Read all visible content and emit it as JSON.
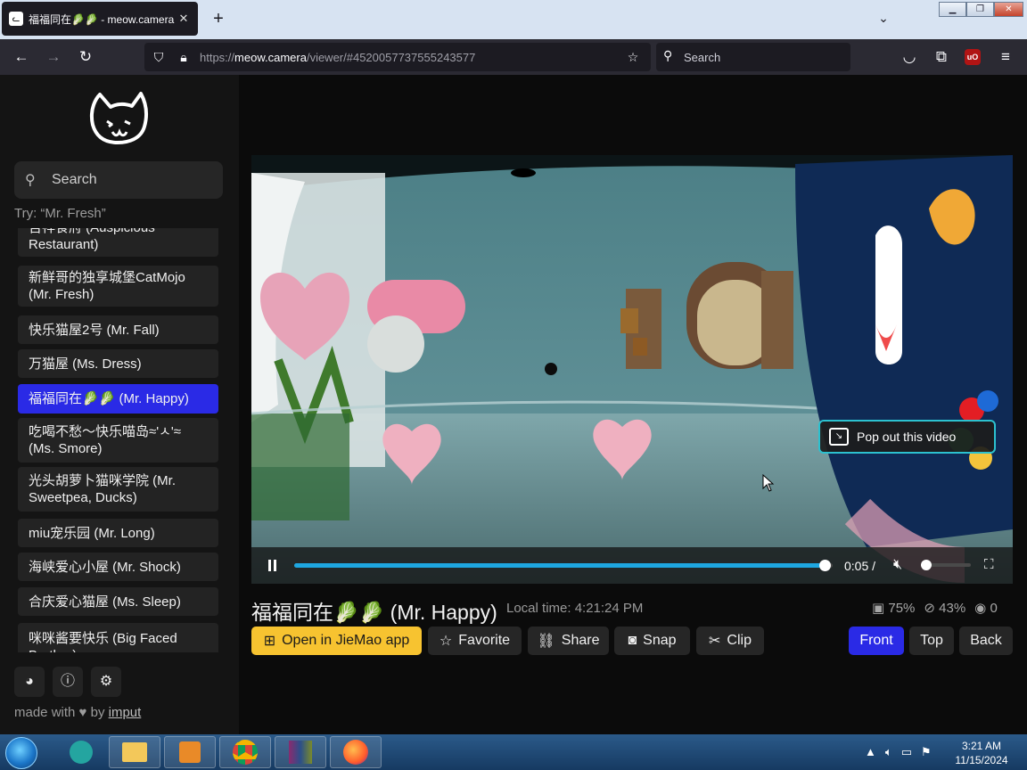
{
  "browser": {
    "tab_title": "福福同在🥬🥬 - meow.camera",
    "url_prefix": "https://",
    "url_host": "meow.camera",
    "url_path": "/viewer/#4520057737555243577",
    "search_placeholder": "Search"
  },
  "sidebar": {
    "search_placeholder": "Search",
    "hint": "Try: “Mr. Fresh”",
    "items": [
      {
        "label": "吉祥食府 (Auspicious Restaurant)"
      },
      {
        "label": "新鲜哥的独享城堡CatMojo (Mr. Fresh)"
      },
      {
        "label": "快乐猫屋2号 (Mr. Fall)"
      },
      {
        "label": "万猫屋 (Ms. Dress)"
      },
      {
        "label": "福福同在🥬🥬 (Mr. Happy)"
      },
      {
        "label": "吃喝不愁～快乐喵岛≈'ㅅ'≈ (Ms. Smore)"
      },
      {
        "label": "光头胡萝卜猫咪学院 (Mr. Sweetpea, Ducks)"
      },
      {
        "label": "miu宠乐园 (Mr. Long)"
      },
      {
        "label": "海峡爱心小屋 (Mr. Shock)"
      },
      {
        "label": "合庆爱心猫屋 (Ms. Sleep)"
      },
      {
        "label": "咪咪酱要快乐 (Big Faced Brother)"
      }
    ],
    "made_with_prefix": "made with ♥ by",
    "made_with_link": "imput"
  },
  "player": {
    "time": "0:05 /",
    "progress": 0.985,
    "volume": 0.0,
    "popout_label": "Pop out this video"
  },
  "camera": {
    "title": "福福同在🥬🥬 (Mr. Happy)",
    "local_time": "Local time: 4:21:24 PM",
    "food": "75%",
    "water": "43%",
    "viewers": "0"
  },
  "buttons": {
    "open_app": "Open in JieMao app",
    "favorite": "Favorite",
    "share": "Share",
    "snap": "Snap",
    "clip": "Clip",
    "front": "Front",
    "top": "Top",
    "back": "Back"
  },
  "taskbar": {
    "clock_time": "3:21 AM",
    "clock_date": "11/15/2024"
  },
  "colors": {
    "accent_blue": "#2a2ae6",
    "accent_yellow": "#f7c330",
    "progress": "#1ea7e1",
    "popout_border": "#2cc1cf"
  }
}
